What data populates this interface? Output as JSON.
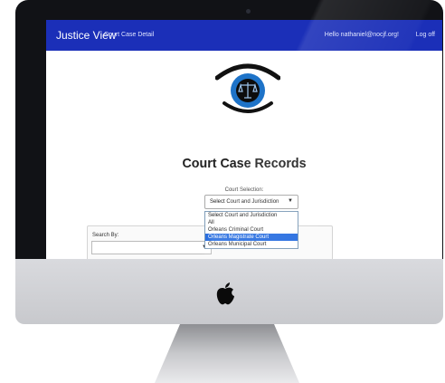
{
  "navbar": {
    "brand": "Justice View",
    "case_link": "Court Case Detail",
    "greeting": "Hello nathaniel@nocjf.org!",
    "logoff": "Log off",
    "color": "#1b2fb8"
  },
  "main": {
    "title": "Court Case Records",
    "court_selection_label": "Court Selection:",
    "court_select_value": "Select Court and Jurisdiction",
    "court_options": [
      "Select Court and Jurisdiction",
      "All",
      "Orleans Criminal Court",
      "Orleans Magistrate Court",
      "Orleans Municipal Court"
    ],
    "highlighted_option": "Orleans Magistrate Court",
    "search_by_label": "Search By:"
  },
  "icons": {
    "logo": "eye-with-scales-icon",
    "dropdown_arrow": "chevron-down-icon",
    "apple": "apple-logo-icon"
  },
  "colors": {
    "accent": "#2a6fe0",
    "eye_blue": "#1e73c8"
  }
}
